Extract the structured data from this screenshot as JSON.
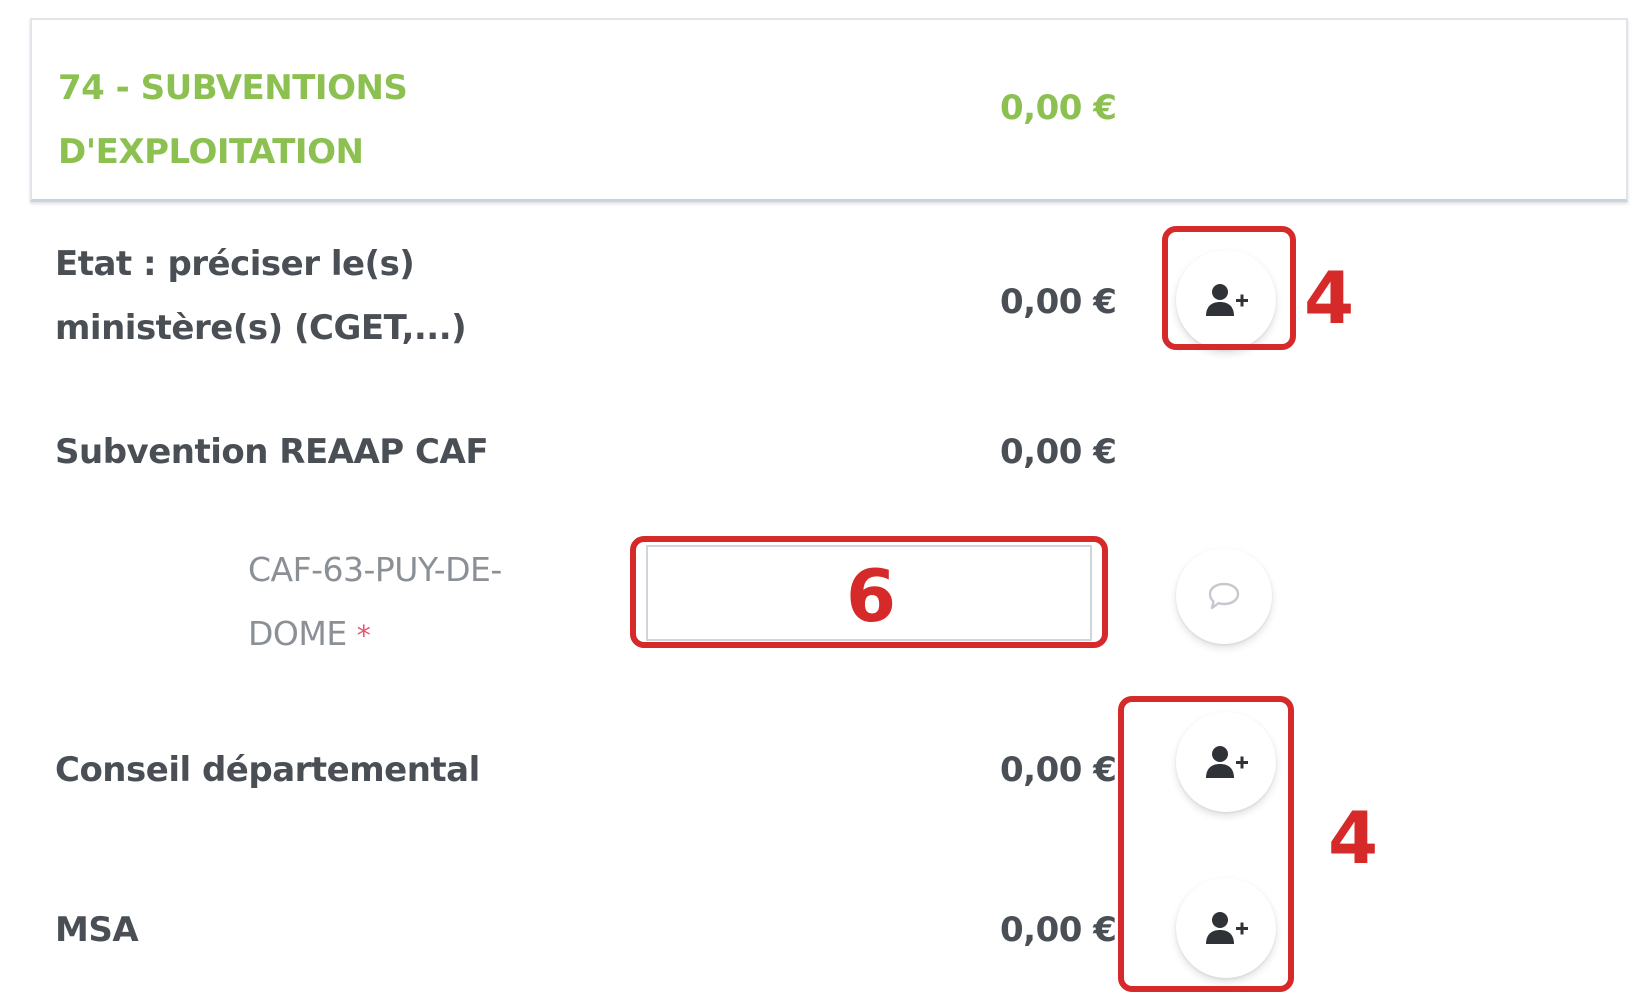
{
  "section": {
    "title": "74 - SUBVENTIONS D'EXPLOITATION",
    "amount": "0,00 €",
    "accent_color": "#8cc152"
  },
  "rows": [
    {
      "label": "Etat : préciser le(s) ministère(s) (CGET,...)",
      "amount": "0,00 €",
      "action_icon": "add-user-icon"
    },
    {
      "label": "Subvention REAAP CAF",
      "amount": "0,00 €"
    },
    {
      "label": "Conseil départemental",
      "amount": "0,00 €",
      "action_icon": "add-user-icon"
    },
    {
      "label": "MSA",
      "amount": "0,00 €",
      "action_icon": "add-user-icon"
    }
  ],
  "sub_row": {
    "label": "CAF-63-PUY-DE-DOME",
    "required_marker": "*",
    "input_value": "",
    "action_icon": "comment-icon"
  },
  "annotations": {
    "color": "#d62a2a",
    "label_a": "4",
    "label_b": "6",
    "label_c": "4"
  }
}
